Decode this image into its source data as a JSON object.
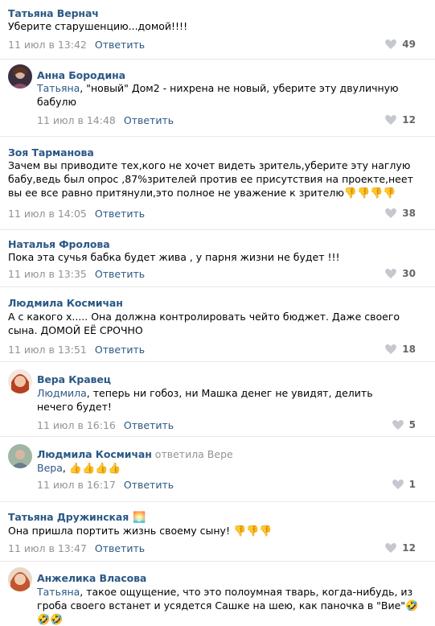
{
  "icons": {
    "like": "heart-icon",
    "thumb_down": "thumbs-down-emoji",
    "thumb_up": "thumbs-up-emoji",
    "rofl": "rofl-emoji",
    "sunset": "sunset-emoji"
  },
  "colors": {
    "link": "#2a5885",
    "meta": "#939393",
    "divider": "#e7e8ec",
    "likes": "#656565"
  },
  "comments": [
    {
      "author": "Татьяна Вернач",
      "text": "Уберите старушенцию...домой!!!!",
      "date": "11 июл в 13:42",
      "reply": "Ответить",
      "likes": "49"
    },
    {
      "author": "Анна Бородина",
      "mention": "Татьяна",
      "text": ", \"новый\" Дом2 - нихрена не новый, уберите эту двуличную бабулю",
      "date": "11 июл в 14:48",
      "reply": "Ответить",
      "likes": "12"
    },
    {
      "author": "Зоя Тарманова",
      "text": "Зачем вы приводите тех,кого не хочет видеть зритель,уберите эту наглую бабу,ведь был опрос ,87%зрителей против ее присутствия на проекте,неет вы ее все равно притянули,это полное не уважение к зрителю",
      "date": "11 июл в 14:05",
      "reply": "Ответить",
      "likes": "38"
    },
    {
      "author": "Наталья Фролова",
      "text": "Пока эта сучья бабка будет жива , у парня жизни не будет !!!",
      "date": "11 июл в 13:35",
      "reply": "Ответить",
      "likes": "30"
    },
    {
      "author": "Людмила Космичан",
      "text": "А с какого х..... Она должна контролировать чейто бюджет. Даже своего сына. ДОМОЙ ЕЁ СРОЧНО",
      "date": "11 июл в 13:51",
      "reply": "Ответить",
      "likes": "18"
    },
    {
      "author": "Вера Кравец",
      "mention": "Людмила",
      "text": ", теперь ни гобоз, ни Машка денег не увидят, делить нечего будет!",
      "date": "11 июл в 16:16",
      "reply": "Ответить",
      "likes": "5"
    },
    {
      "author": "Людмила Космичан",
      "replied": "ответила Вере",
      "mention": "Вера",
      "text": ",",
      "date": "11 июл в 16:17",
      "reply": "Ответить",
      "likes": "1"
    },
    {
      "author": "Татьяна Дружинская",
      "text": "Она пришла портить жизнь своему сыну!",
      "date": "11 июл в 13:47",
      "reply": "Ответить",
      "likes": "12"
    },
    {
      "author": "Анжелика Власова",
      "mention": "Татьяна",
      "text": ", такое ощущение, что это полоумная тварь, когда-нибудь, из гроба своего встанет и усядется Сашке на шею, как паночка в \"Вие\""
    }
  ]
}
